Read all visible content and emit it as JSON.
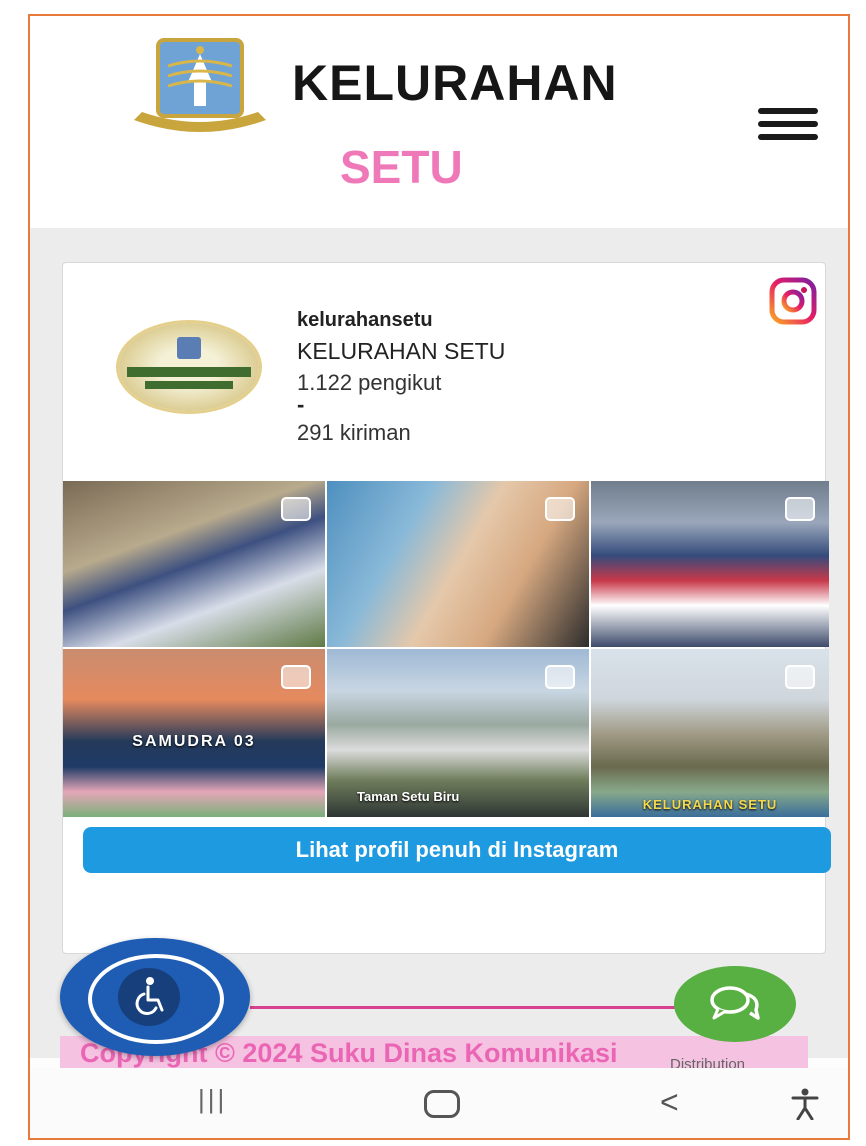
{
  "header": {
    "title": "KELURAHAN",
    "subtitle": "SETU",
    "logo_icon": "dki-jakarta-emblem-icon",
    "menu_icon": "hamburger-menu-icon"
  },
  "instagram": {
    "username": "kelurahansetu",
    "display_name": "KELURAHAN SETU",
    "followers": "1.122 pengikut",
    "separator": "-",
    "posts": "291 kiriman",
    "icon": "instagram-icon",
    "posts_grid": [
      {
        "caption": "",
        "icon": "multi-image-icon"
      },
      {
        "caption": "",
        "icon": "multi-image-icon"
      },
      {
        "caption": "",
        "icon": "multi-image-icon"
      },
      {
        "caption": "SAMUDRA 03",
        "icon": "multi-image-icon"
      },
      {
        "caption": "Taman Setu Biru",
        "icon": "multi-image-icon"
      },
      {
        "caption": "KELURAHAN SETU",
        "icon": "multi-image-icon"
      }
    ],
    "view_profile_label": "Lihat profil penuh di Instagram"
  },
  "floating": {
    "accessibility_icon": "wheelchair-accessibility-icon",
    "chat_icon": "chat-bubbles-icon"
  },
  "footer": {
    "copyright": "Copyright © 2024 Suku Dinas Komunikasi",
    "distribution": "Distribution"
  },
  "navbar": {
    "recents_label": "|||",
    "back_label": "<",
    "home_icon": "home-icon",
    "accessibility_icon": "accessibility-person-icon"
  },
  "colors": {
    "accent_pink": "#ef78b8",
    "instagram_button": "#1e9ae0",
    "frame_orange": "#e87a3c",
    "accessibility_blue": "#1f5db5",
    "chat_green": "#58b042"
  }
}
